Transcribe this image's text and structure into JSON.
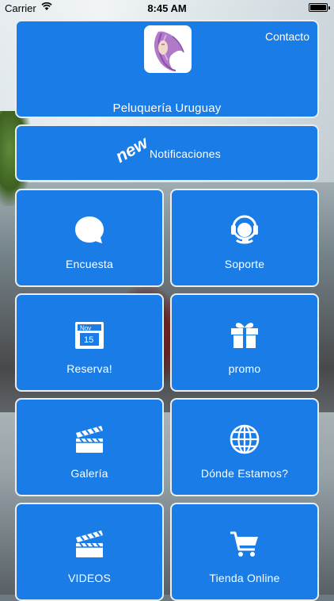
{
  "status": {
    "carrier": "Carrier",
    "time": "8:45 AM"
  },
  "header": {
    "title": "Peluquería Uruguay",
    "contact": "Contacto"
  },
  "notificaciones": {
    "badge": "new",
    "label": "Notificaciones"
  },
  "tiles": {
    "encuesta": "Encuesta",
    "soporte": "Soporte",
    "reserva": "Reserva!",
    "promo": "promo",
    "galeria": "Galería",
    "donde": "Dónde Estamos?",
    "videos": "VIDEOS",
    "tienda": "Tienda Online"
  },
  "calendar": {
    "month": "Nov",
    "day": "15"
  },
  "colors": {
    "tile": "#1a7ce6",
    "border": "#e9eef2"
  },
  "icons": {
    "encuesta": "speech-bubble-icon",
    "soporte": "headset-icon",
    "reserva": "calendar-icon",
    "promo": "gift-icon",
    "galeria": "clapperboard-icon",
    "donde": "globe-icon",
    "videos": "clapperboard-icon",
    "tienda": "cart-icon"
  }
}
